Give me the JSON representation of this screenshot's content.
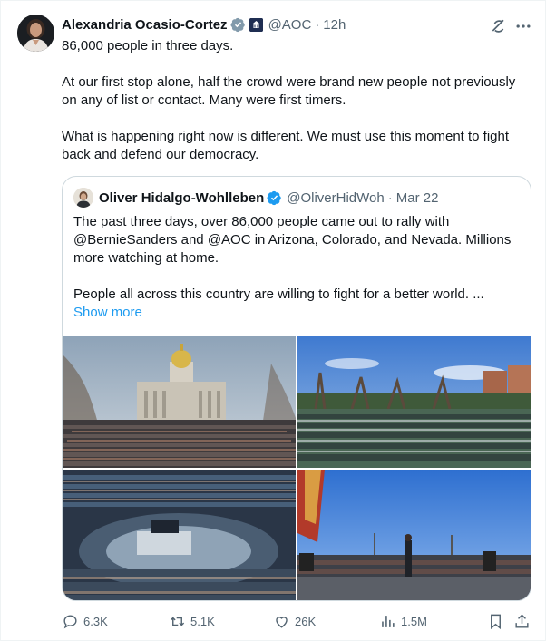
{
  "post": {
    "author_name": "Alexandria Ocasio-Cortez",
    "handle": "@AOC",
    "separator": "·",
    "time": "12h",
    "paragraphs": [
      "86,000 people in three days.",
      "At our first stop alone, half the crowd were brand new people not previously on any of list or contact. Many were first timers.",
      "What is happening right now is different. We must use this moment to fight back and defend our democracy."
    ]
  },
  "quote": {
    "author_name": "Oliver Hidalgo-Wohlleben",
    "handle": "@OliverHidWoh",
    "separator": "·",
    "date": "Mar 22",
    "paragraphs": [
      "The past three days, over 86,000 people came out to rally with @BernieSanders and @AOC in Arizona, Colorado, and Nevada. Millions more watching at home.",
      "People all across this country are willing to fight for a better world. ..."
    ],
    "show_more": "Show more"
  },
  "actions": {
    "replies": "6.3K",
    "reposts": "5.1K",
    "likes": "26K",
    "views": "1.5M"
  },
  "colors": {
    "text": "#0f1419",
    "secondary": "#536471",
    "link": "#1d9bf0",
    "verified": "#1d9bf0",
    "border": "#cfd9de"
  },
  "icons": [
    "verified-badge-icon",
    "government-badge-icon",
    "grok-icon",
    "more-icon",
    "reply-icon",
    "repost-icon",
    "like-icon",
    "views-icon",
    "bookmark-icon",
    "share-icon"
  ]
}
